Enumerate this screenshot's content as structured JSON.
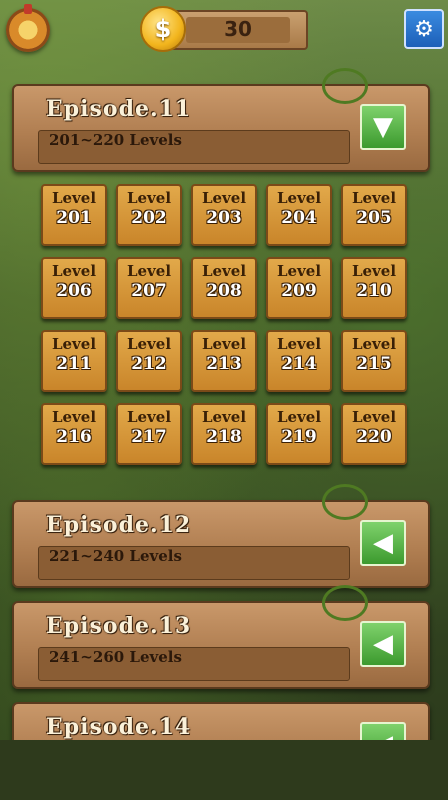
{
  "header": {
    "coins": "30",
    "coin_symbol": "$",
    "settings_icon": "gear-icon",
    "wheel_icon": "spin-wheel-icon"
  },
  "episodes": [
    {
      "title": "Episode.11",
      "range": "201~220 Levels",
      "toggle": "▼",
      "expanded": true
    },
    {
      "title": "Episode.12",
      "range": "221~240 Levels",
      "toggle": "◀",
      "expanded": false
    },
    {
      "title": "Episode.13",
      "range": "241~260 Levels",
      "toggle": "◀",
      "expanded": false
    },
    {
      "title": "Episode.14",
      "range": "",
      "toggle": "◀",
      "expanded": false
    }
  ],
  "level_label": "Level",
  "levels": [
    "201",
    "202",
    "203",
    "204",
    "205",
    "206",
    "207",
    "208",
    "209",
    "210",
    "211",
    "212",
    "213",
    "214",
    "215",
    "216",
    "217",
    "218",
    "219",
    "220"
  ],
  "colors": {
    "wood": "#b17f52",
    "toggle_green": "#3c9a2e",
    "level_tile": "#d9982f",
    "settings_blue": "#1d5fb8"
  }
}
